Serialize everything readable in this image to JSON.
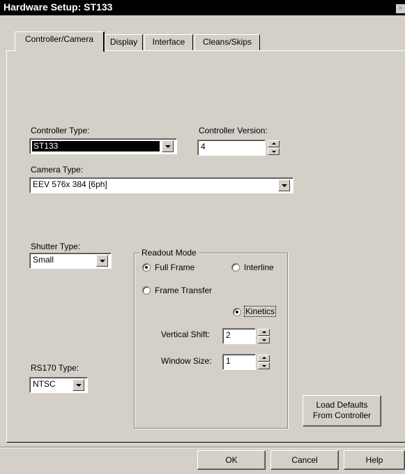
{
  "window": {
    "title": "Hardware Setup: ST133",
    "close_glyph": "×"
  },
  "tabs": [
    {
      "label": "Controller/Camera",
      "active": true
    },
    {
      "label": "Display",
      "active": false
    },
    {
      "label": "Interface",
      "active": false
    },
    {
      "label": "Cleans/Skips",
      "active": false
    }
  ],
  "controller": {
    "type_label": "Controller Type:",
    "type_value": "ST133",
    "version_label": "Controller Version:",
    "version_value": "4"
  },
  "camera": {
    "type_label": "Camera Type:",
    "type_value": "EEV  576x 384 [6ph]"
  },
  "shutter": {
    "label": "Shutter Type:",
    "value": "Small"
  },
  "readout": {
    "label": "Readout Mode",
    "options": {
      "full_frame": {
        "label": "Full Frame",
        "checked": true
      },
      "interline": {
        "label": "Interline",
        "checked": false
      },
      "frame_transfer": {
        "label": "Frame Transfer",
        "checked": false
      },
      "kinetics": {
        "label": "Kinetics",
        "checked": true
      }
    },
    "vertical_shift_label": "Vertical Shift:",
    "vertical_shift_value": "2",
    "window_size_label": "Window Size:",
    "window_size_value": "1"
  },
  "rs170": {
    "label": "RS170 Type:",
    "value": "NTSC"
  },
  "buttons": {
    "load_defaults_line1": "Load Defaults",
    "load_defaults_line2": "From Controller",
    "ok": "OK",
    "cancel": "Cancel",
    "help": "Help"
  }
}
